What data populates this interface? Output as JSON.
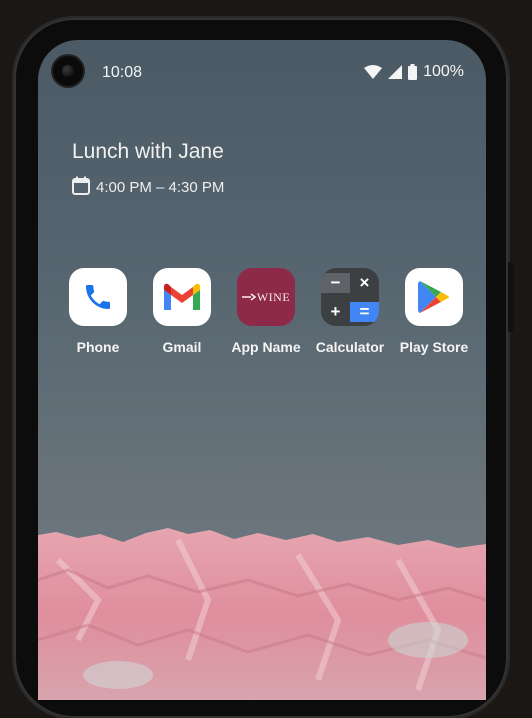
{
  "status_bar": {
    "time": "10:08",
    "battery": "100%",
    "icons": [
      "wifi-icon",
      "signal-icon",
      "battery-icon"
    ]
  },
  "event_widget": {
    "title": "Lunch with Jane",
    "time": "4:00 PM – 4:30 PM",
    "icon": "calendar-icon"
  },
  "apps": [
    {
      "label": "Phone",
      "icon": "phone-icon"
    },
    {
      "label": "Gmail",
      "icon": "gmail-icon"
    },
    {
      "label": "App Name",
      "icon": "wine-app-icon",
      "logo_text": "WINE",
      "color": "#8e2a49"
    },
    {
      "label": "Calculator",
      "icon": "calculator-icon"
    },
    {
      "label": "Play Store",
      "icon": "play-store-icon"
    }
  ],
  "calculator_symbols": [
    "−",
    "×",
    "+",
    "="
  ],
  "colors": {
    "wallpaper_sky": "#56656f",
    "mountains": "#e59aa6",
    "text": "#f4f4f4"
  }
}
